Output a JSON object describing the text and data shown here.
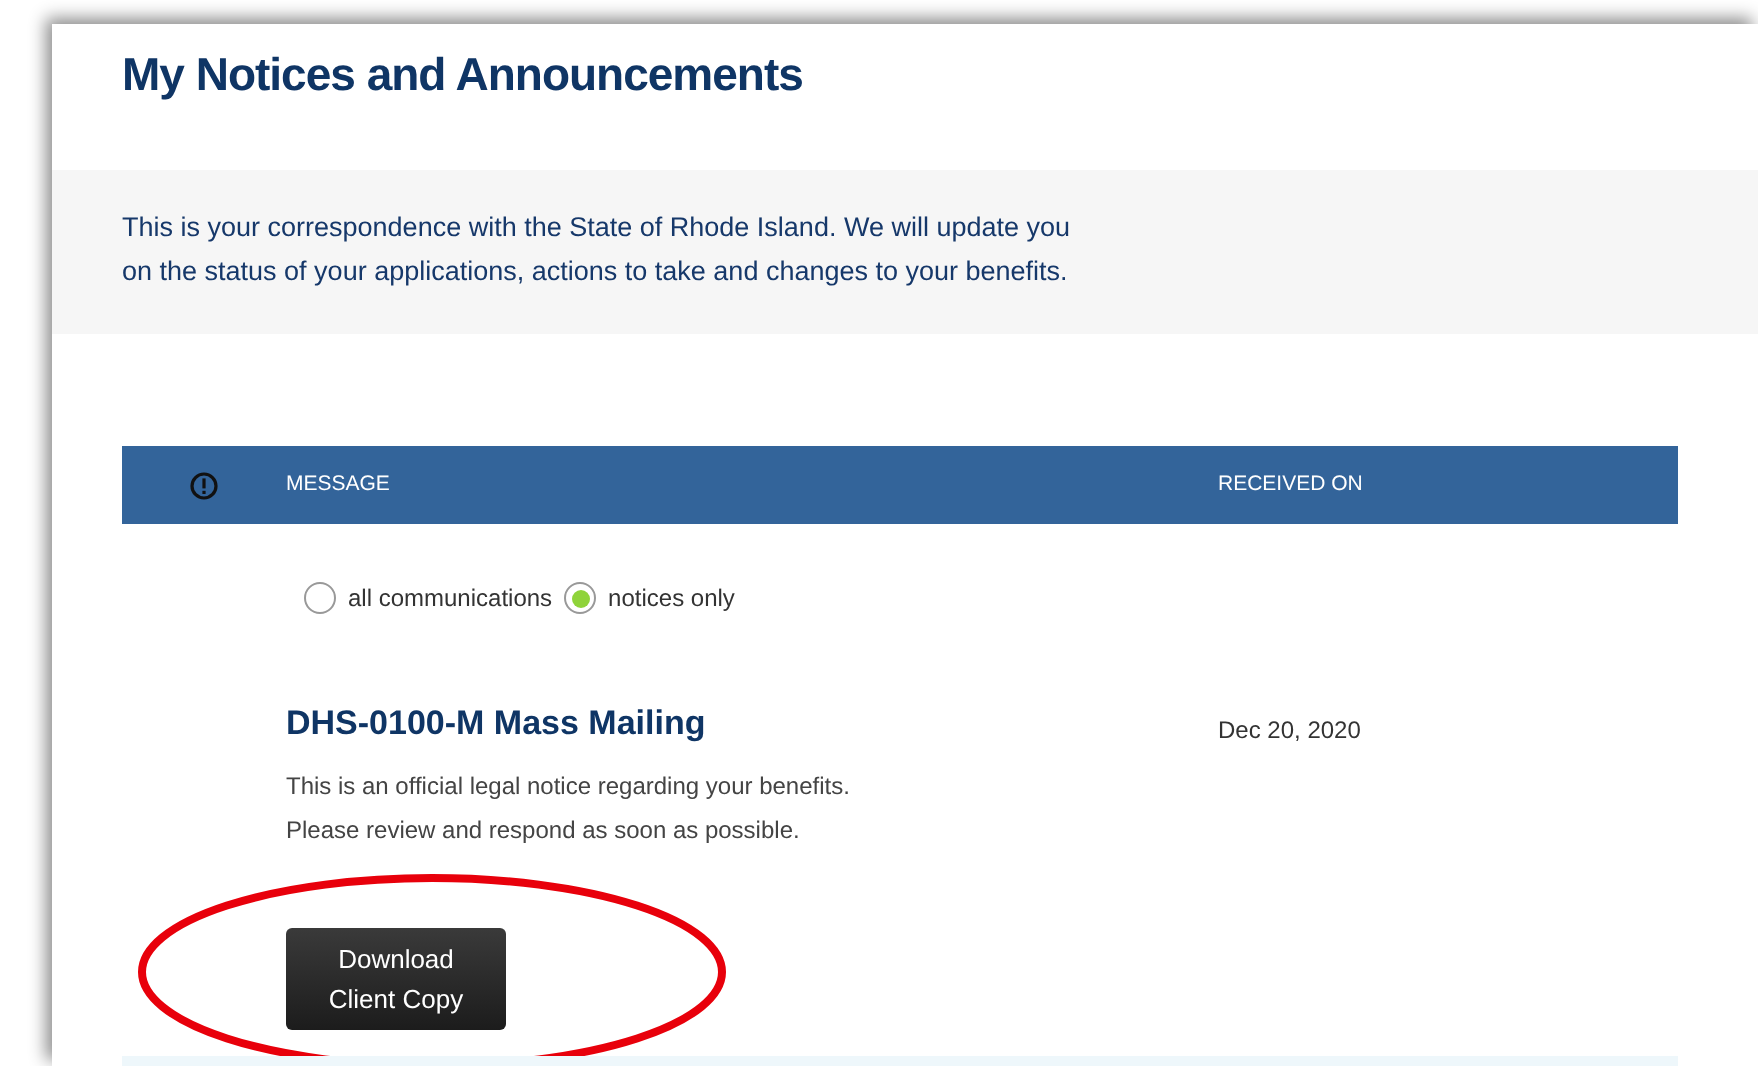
{
  "page": {
    "title": "My Notices and Announcements",
    "intro": "This is your correspondence with the State of Rhode Island. We will update you on the status of your applications, actions to take and changes to your benefits."
  },
  "table": {
    "columns": [
      {
        "kind": "icon"
      },
      {
        "kind": "text",
        "label": "MESSAGE"
      },
      {
        "kind": "text",
        "label": "RECEIVED ON"
      }
    ]
  },
  "filters": [
    {
      "label": "all communications",
      "selected": false
    },
    {
      "label": "notices only",
      "selected": true
    }
  ],
  "messages": [
    {
      "title": "DHS-0100-M Mass Mailing",
      "lines": [
        "This is an official legal notice regarding your benefits.",
        "Please review and respond as soon as possible."
      ],
      "received_on": "Dec 20, 2020",
      "button": "Download Client Copy",
      "highlighted": true,
      "color": "#e8000b"
    }
  ]
}
